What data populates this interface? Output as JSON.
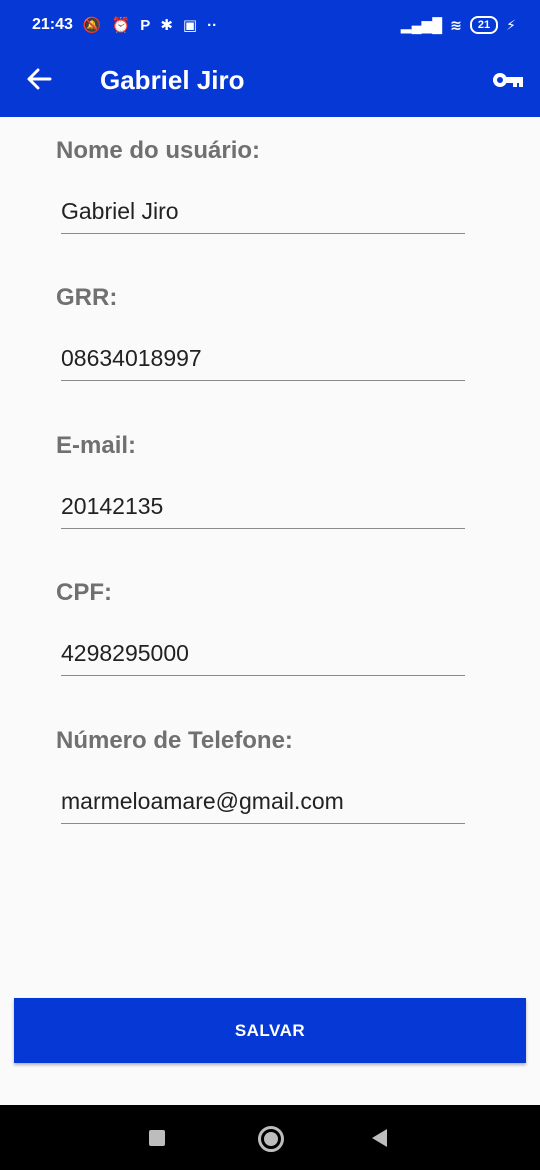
{
  "status_bar": {
    "time": "21:43",
    "left_icons": [
      "mute-icon",
      "alarm-icon",
      "p-icon",
      "slack-icon",
      "gallery-icon",
      "more-dots-icon"
    ],
    "battery": "21"
  },
  "app_bar": {
    "title": "Gabriel Jiro"
  },
  "form": {
    "fields": [
      {
        "label": "Nome do usuário:",
        "value": "Gabriel Jiro"
      },
      {
        "label": "GRR:",
        "value": "08634018997"
      },
      {
        "label": "E-mail:",
        "value": "20142135"
      },
      {
        "label": "CPF:",
        "value": "4298295000"
      },
      {
        "label": "Número de Telefone:",
        "value": "marmeloamare@gmail.com"
      }
    ]
  },
  "actions": {
    "save_label": "SALVAR"
  },
  "colors": {
    "primary": "#0538d4",
    "label": "#707070",
    "background": "#fafafa"
  }
}
